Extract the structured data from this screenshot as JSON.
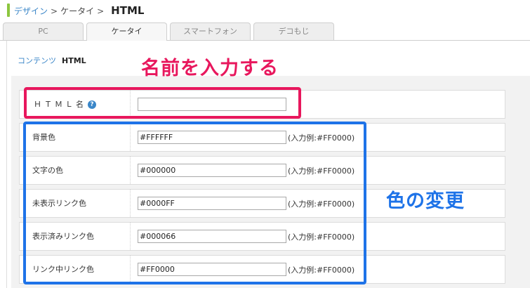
{
  "breadcrumb": {
    "design": "デザイン",
    "mobile": "ケータイ",
    "current": "HTML",
    "separator": ">"
  },
  "tabs": [
    "PC",
    "ケータイ",
    "スマートフォン",
    "デコもじ"
  ],
  "subnav": {
    "contents": "コンテンツ",
    "current": "HTML"
  },
  "form": {
    "html_name": {
      "label": "ＨＴＭＬ名",
      "help": "?",
      "value": ""
    },
    "fields": [
      {
        "label": "背景色",
        "value": "#FFFFFF",
        "example": "(入力例:#FF0000)"
      },
      {
        "label": "文字の色",
        "value": "#000000",
        "example": "(入力例:#FF0000)"
      },
      {
        "label": "未表示リンク色",
        "value": "#0000FF",
        "example": "(入力例:#FF0000)"
      },
      {
        "label": "表示済みリンク色",
        "value": "#000066",
        "example": "(入力例:#FF0000)"
      },
      {
        "label": "リンク中リンク色",
        "value": "#FF0000",
        "example": "(入力例:#FF0000)"
      }
    ]
  },
  "annotations": {
    "name": "名前を入力する",
    "color": "色の変更"
  },
  "colors": {
    "accent_red": "#e8175d",
    "accent_blue": "#1e73e8",
    "link": "#3a86c8",
    "breadcrumb_bar": "#8cc63f"
  }
}
